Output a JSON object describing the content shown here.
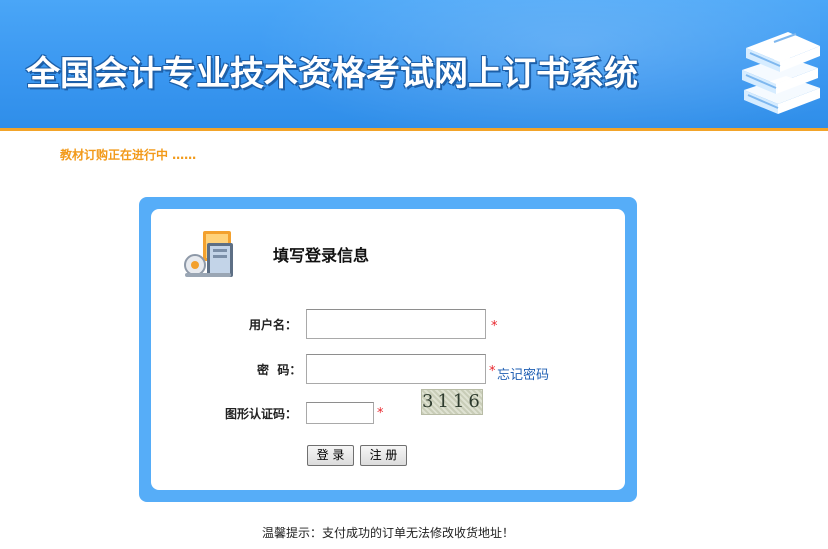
{
  "banner": {
    "title": "全国会计专业技术资格考试网上订书系统",
    "icon": "books-icon",
    "accent_color": "#3996f0",
    "underline_color": "#f2a42a"
  },
  "notice": {
    "text": "教材订购正在进行中 ……",
    "color": "#f29a1a"
  },
  "login": {
    "title": "填写登录信息",
    "icon": "computer-login-icon",
    "username": {
      "label": "用户名：",
      "value": "",
      "required_mark": "*"
    },
    "password": {
      "label": "密  码：",
      "value": "",
      "required_mark": "*",
      "forgot_link": "忘记密码"
    },
    "captcha": {
      "label": "图形认证码：",
      "value": "",
      "required_mark": "*",
      "image_text": "3116"
    },
    "login_button": "登 录",
    "register_button": "注 册",
    "frame_color": "#56adf8"
  },
  "footer": {
    "tip": "温馨提示：支付成功的订单无法修改收货地址！"
  }
}
